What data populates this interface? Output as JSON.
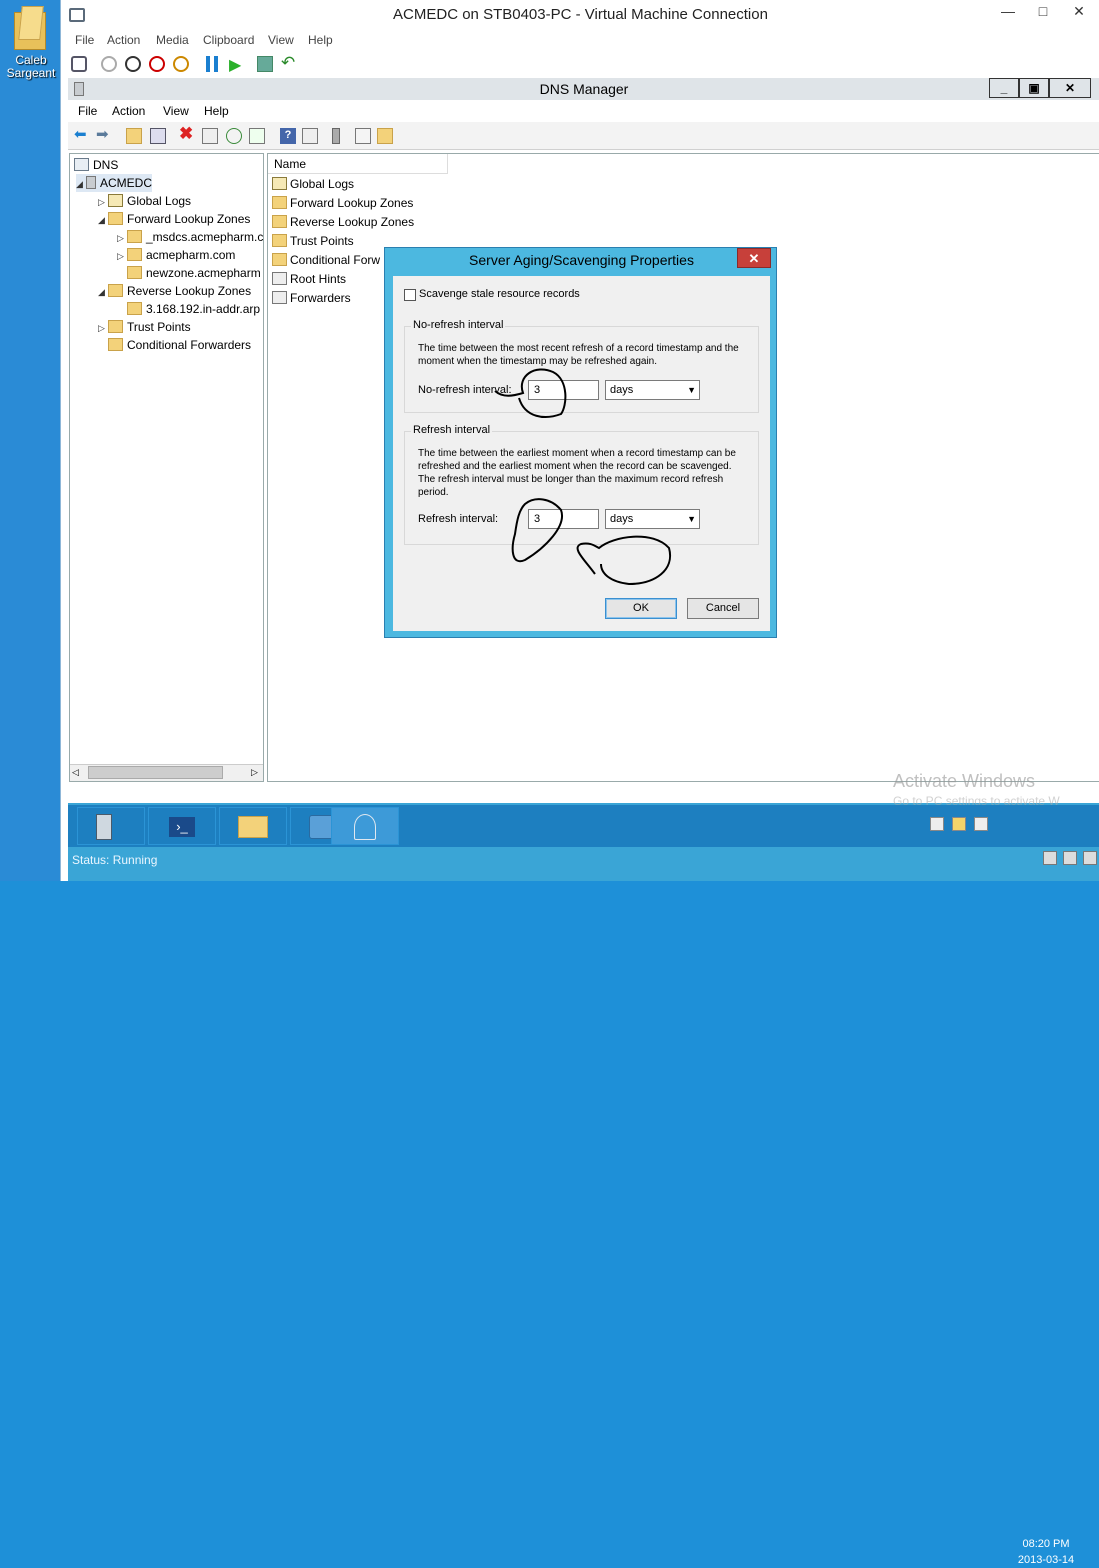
{
  "host": {
    "desktop_icon_label": "Caleb\nSargeant"
  },
  "vm_window": {
    "title": "ACMEDC on STB0403-PC - Virtual Machine Connection",
    "menu": [
      "File",
      "Action",
      "Media",
      "Clipboard",
      "View",
      "Help"
    ],
    "controls": {
      "minimize": "—",
      "maximize": "□",
      "close": "✕"
    },
    "status": "Status: Running"
  },
  "dns_manager": {
    "title": "DNS Manager",
    "menu": [
      "File",
      "Action",
      "View",
      "Help"
    ],
    "controls": {
      "minimize": "_",
      "restore": "▣",
      "close": "✕"
    },
    "tree": {
      "root": "DNS",
      "server": "ACMEDC",
      "global_logs": "Global Logs",
      "forward_zones": "Forward Lookup Zones",
      "fz_items": [
        "_msdcs.acmepharm.c",
        "acmepharm.com",
        "newzone.acmepharm"
      ],
      "reverse_zones": "Reverse Lookup Zones",
      "rz_items": [
        "3.168.192.in-addr.arp"
      ],
      "trust_points": "Trust Points",
      "conditional_forwarders": "Conditional Forwarders"
    },
    "list": {
      "column_name": "Name",
      "items": [
        "Global Logs",
        "Forward Lookup Zones",
        "Reverse Lookup Zones",
        "Trust Points",
        "Conditional Forw",
        "Root Hints",
        "Forwarders"
      ]
    }
  },
  "dialog": {
    "title": "Server Aging/Scavenging Properties",
    "close": "✕",
    "scavenge_label": "Scavenge stale resource records",
    "no_refresh": {
      "group_label": "No-refresh interval",
      "description": "The time between the most recent refresh of a record timestamp and the moment when the timestamp may be refreshed again.",
      "field_label": "No-refresh interval:",
      "value": "3",
      "unit": "days"
    },
    "refresh": {
      "group_label": "Refresh interval",
      "description": "The time between the earliest moment when a record timestamp can be refreshed and the earliest moment when the record can be scavenged. The refresh interval must be longer than the maximum record refresh period.",
      "field_label": "Refresh interval:",
      "value": "3",
      "unit": "days"
    },
    "ok_label": "OK",
    "cancel_label": "Cancel"
  },
  "taskbar": {
    "clock_time": "08:20 PM",
    "clock_date": "2013-03-14"
  },
  "watermark": {
    "line1": "Activate Windows",
    "line2": "Go to PC settings to activate W"
  }
}
